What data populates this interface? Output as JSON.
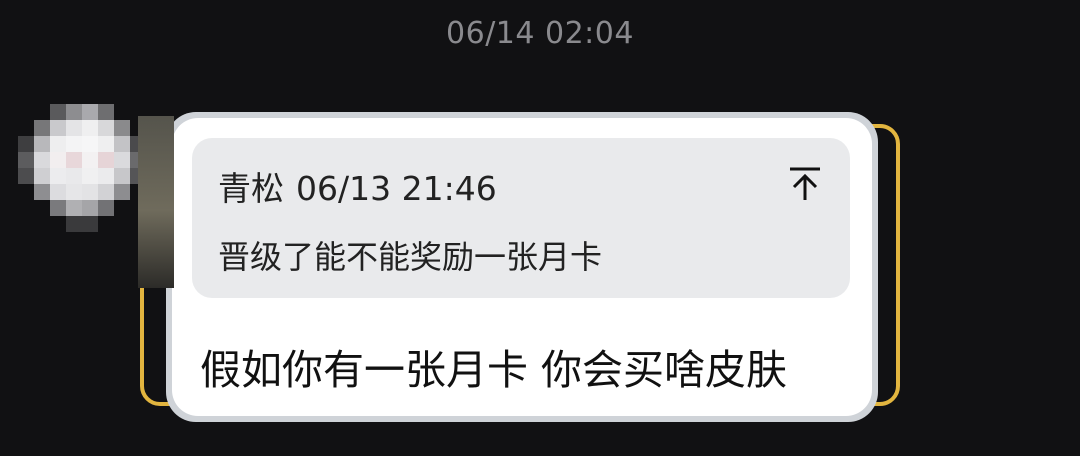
{
  "chat": {
    "timestamp": "06/14 02:04"
  },
  "message": {
    "quoted": {
      "sender": "青松",
      "time": "06/13 21:46",
      "text": "晋级了能不能奖励一张月卡",
      "pin_icon": "arrow-up-to-top-icon"
    },
    "text": "假如你有一张月卡 你会买啥皮肤"
  },
  "colors": {
    "background": "#111113",
    "bubble": "#ffffff",
    "quote_bg": "#e9eaec",
    "frame_gold": "#e2b53f",
    "timestamp": "#8a8a8e"
  }
}
